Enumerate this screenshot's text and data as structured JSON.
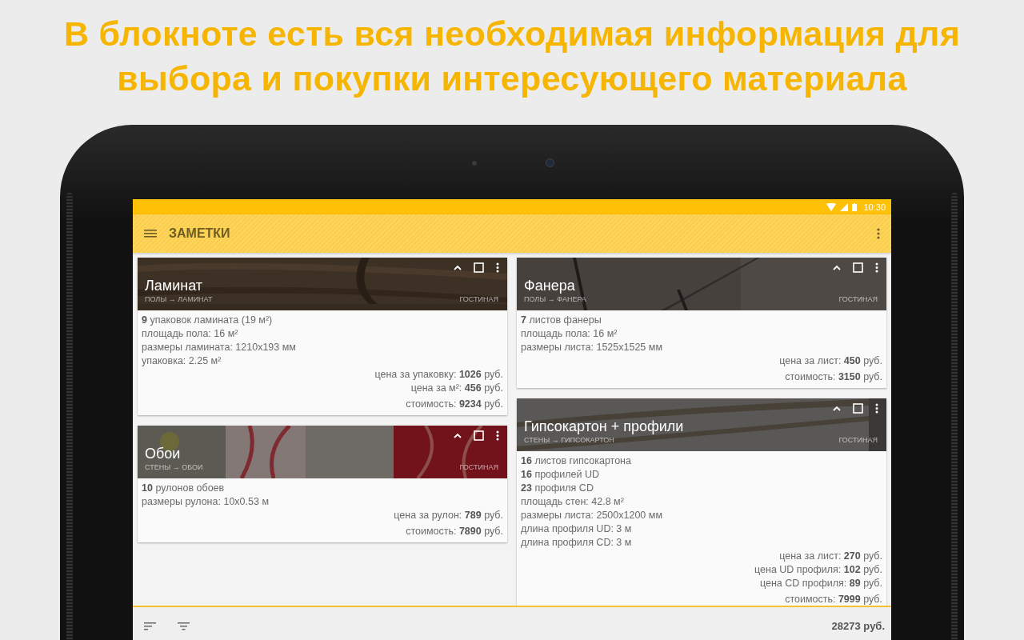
{
  "headline": "В блокноте есть вся необходимая информация для выбора и покупки интересующего материала",
  "status_bar": {
    "time": "10:30"
  },
  "toolbar": {
    "title": "ЗАМЕТКИ"
  },
  "columns": [
    {
      "cards": [
        {
          "title": "Ламинат",
          "path": "ПОЛЫ → ЛАМИНАТ",
          "room": "ГОСТИНАЯ",
          "checked": false,
          "details": [
            "**9** упаковок ламината (19 м²)",
            "площадь пола: 16 м²",
            "размеры ламината: 1210x193 мм",
            "упаковка: 2.25 м²"
          ],
          "prices": [
            "цена за упаковку: **1026** руб.",
            "цена за м²: **456** руб."
          ],
          "total": "стоимость: **9234** руб."
        },
        {
          "title": "Обои",
          "path": "СТЕНЫ → ОБОИ",
          "room": "ГОСТИНАЯ",
          "checked": false,
          "details": [
            "**10** рулонов обоев",
            "размеры рулона: 10x0.53 м"
          ],
          "prices": [
            "цена за рулон: **789** руб."
          ],
          "total": "стоимость: **7890** руб."
        }
      ]
    },
    {
      "cards": [
        {
          "title": "Фанера",
          "path": "ПОЛЫ → ФАНЕРА",
          "room": "ГОСТИНАЯ",
          "checked": false,
          "details": [
            "**7** листов фанеры",
            "площадь пола: 16 м²",
            "размеры листа: 1525x1525 мм"
          ],
          "prices": [
            "цена за лист: **450** руб."
          ],
          "total": "стоимость: **3150** руб."
        },
        {
          "title": "Гипсокартон + профили",
          "path": "СТЕНЫ → ГИПСОКАРТОН",
          "room": "ГОСТИНАЯ",
          "checked": false,
          "details": [
            "**16** листов гипсокартона",
            "**16** профилей UD",
            "**23** профиля CD",
            "площадь стен: 42.8 м²",
            "размеры листа: 2500x1200 мм",
            "длина профиля UD: 3 м",
            "длина профиля CD: 3 м"
          ],
          "prices": [
            "цена за лист: **270** руб.",
            "цена UD профиля: **102** руб.",
            "цена CD профиля: **89** руб."
          ],
          "total": "стоимость: **7999** руб."
        }
      ]
    }
  ],
  "bottom_bar": {
    "total": "28273 руб."
  }
}
